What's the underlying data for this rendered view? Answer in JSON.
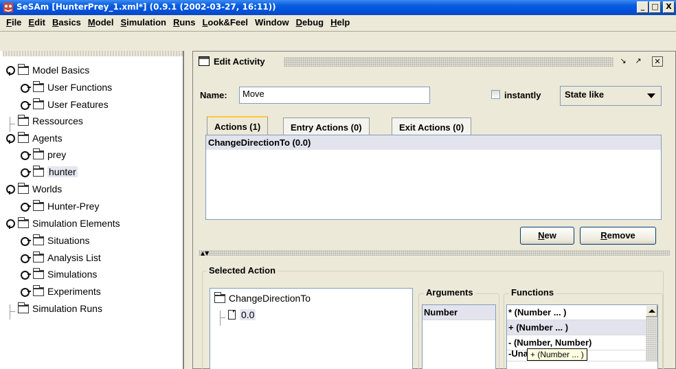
{
  "window": {
    "title": "SeSAm [HunterPrey_1.xml*] (0.9.1 (2002-03-27, 16:11))",
    "buttons": {
      "minimize": "_",
      "maximize": "□",
      "close": "X"
    }
  },
  "menu": [
    {
      "mn": "F",
      "rest": "ile"
    },
    {
      "mn": "E",
      "rest": "dit"
    },
    {
      "mn": "B",
      "rest": "asics"
    },
    {
      "mn": "M",
      "rest": "odel"
    },
    {
      "mn": "S",
      "rest": "imulation"
    },
    {
      "mn": "R",
      "rest": "uns"
    },
    {
      "mn": "L",
      "rest": "ook&Feel"
    },
    {
      "mn": "",
      "rest": "Window"
    },
    {
      "mn": "D",
      "rest": "ebug"
    },
    {
      "mn": "H",
      "rest": "elp"
    }
  ],
  "tree": {
    "model_basics": "Model Basics",
    "user_functions": "User Functions",
    "user_features": "User Features",
    "ressources": "Ressources",
    "agents": "Agents",
    "prey": "prey",
    "hunter": "hunter",
    "worlds": "Worlds",
    "hunter_prey": "Hunter-Prey",
    "simulation_elements": "Simulation Elements",
    "situations": "Situations",
    "analysis_list": "Analysis List",
    "simulations": "Simulations",
    "experiments": "Experiments",
    "simulation_runs": "Simulation Runs"
  },
  "edit_activity": {
    "title": "Edit Activity",
    "name_label": "Name:",
    "name_value": "Move",
    "instantly_label": "instantly",
    "instantly_checked": false,
    "state_combo": "State like",
    "tabs": [
      "Actions (1)",
      "Entry Actions (0)",
      "Exit Actions (0)"
    ],
    "actions": [
      "ChangeDirectionTo (0.0)"
    ],
    "new_button": {
      "mn": "N",
      "rest": "ew"
    },
    "remove_button": {
      "mn": "R",
      "rest": "emove"
    },
    "selected_action": {
      "title": "Selected Action",
      "tree_root": "ChangeDirectionTo",
      "tree_child": "0.0",
      "arguments_title": "Arguments",
      "arguments": [
        "Number"
      ],
      "functions_title": "Functions",
      "functions": [
        "* (Number ... )",
        "+ (Number ... )",
        "- (Number, Number)",
        "-Unary (Number)"
      ],
      "tooltip": "+ (Number ... )"
    }
  }
}
